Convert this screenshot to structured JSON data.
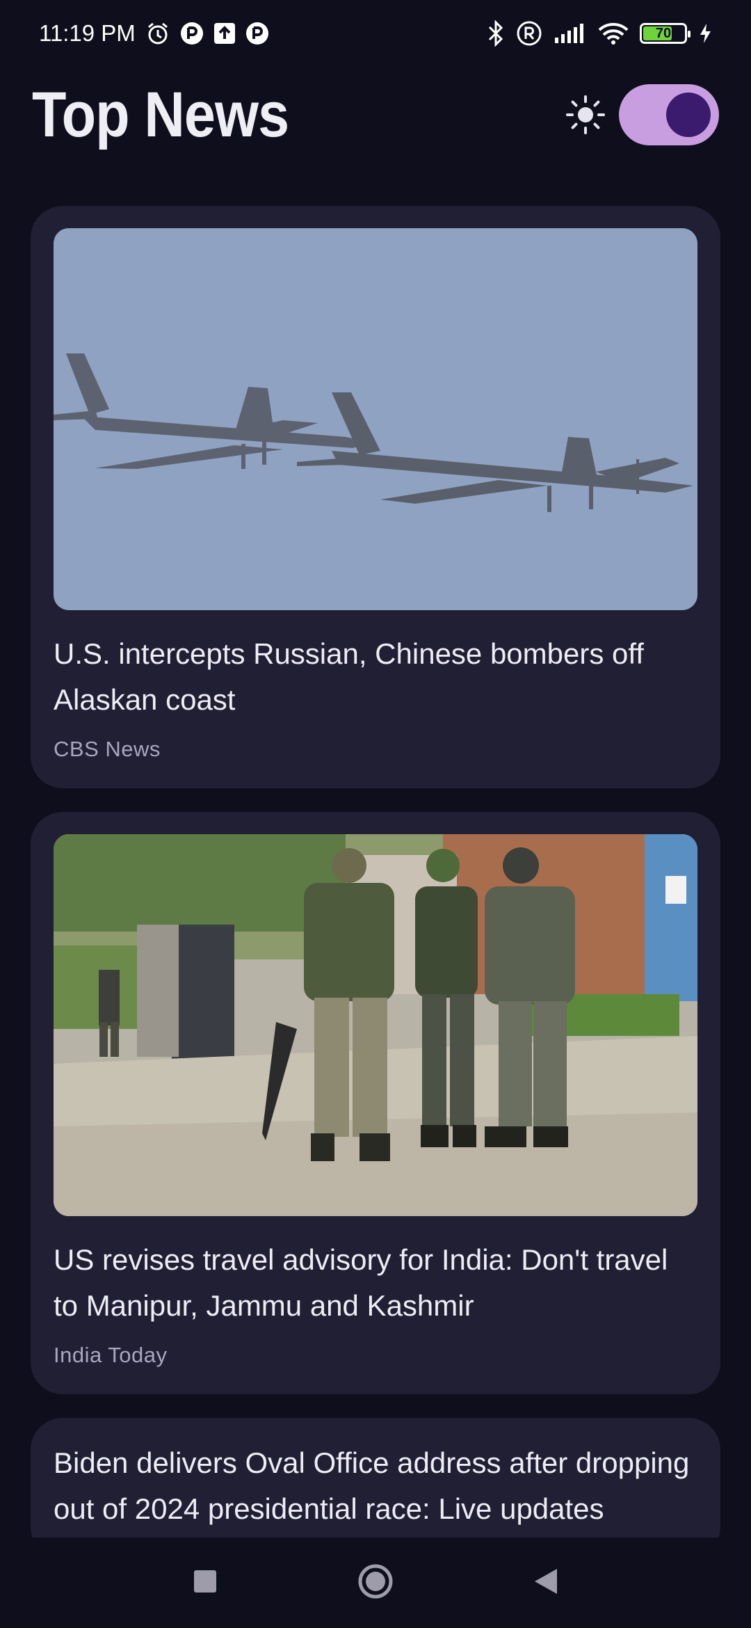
{
  "status": {
    "time": "11:19 PM",
    "battery": "70",
    "icons": [
      "alarm-icon",
      "app-notification-icon",
      "upload-icon",
      "app-notification-icon",
      "bluetooth-icon",
      "registered-icon",
      "signal-icon",
      "wifi-icon",
      "battery-icon",
      "charging-icon"
    ]
  },
  "header": {
    "title": "Top News",
    "theme_icon": "sun-icon",
    "dark_mode": true
  },
  "colors": {
    "background": "#0f0e1c",
    "card": "#211f33",
    "accent": "#c89ee0",
    "knob": "#3b1b6e"
  },
  "articles": [
    {
      "headline": "U.S. intercepts Russian, Chinese bombers off Alaskan coast",
      "source": "CBS News",
      "image": "bombers-photo"
    },
    {
      "headline": "US revises travel advisory for India: Don't travel to Manipur, Jammu and Kashmir",
      "source": "India Today",
      "image": "soldiers-photo"
    },
    {
      "headline": "Biden delivers Oval Office address after dropping out of 2024 presidential race: Live updates",
      "source": ""
    }
  ],
  "nav": {
    "icons": [
      "recents-icon",
      "home-icon",
      "back-icon"
    ]
  }
}
